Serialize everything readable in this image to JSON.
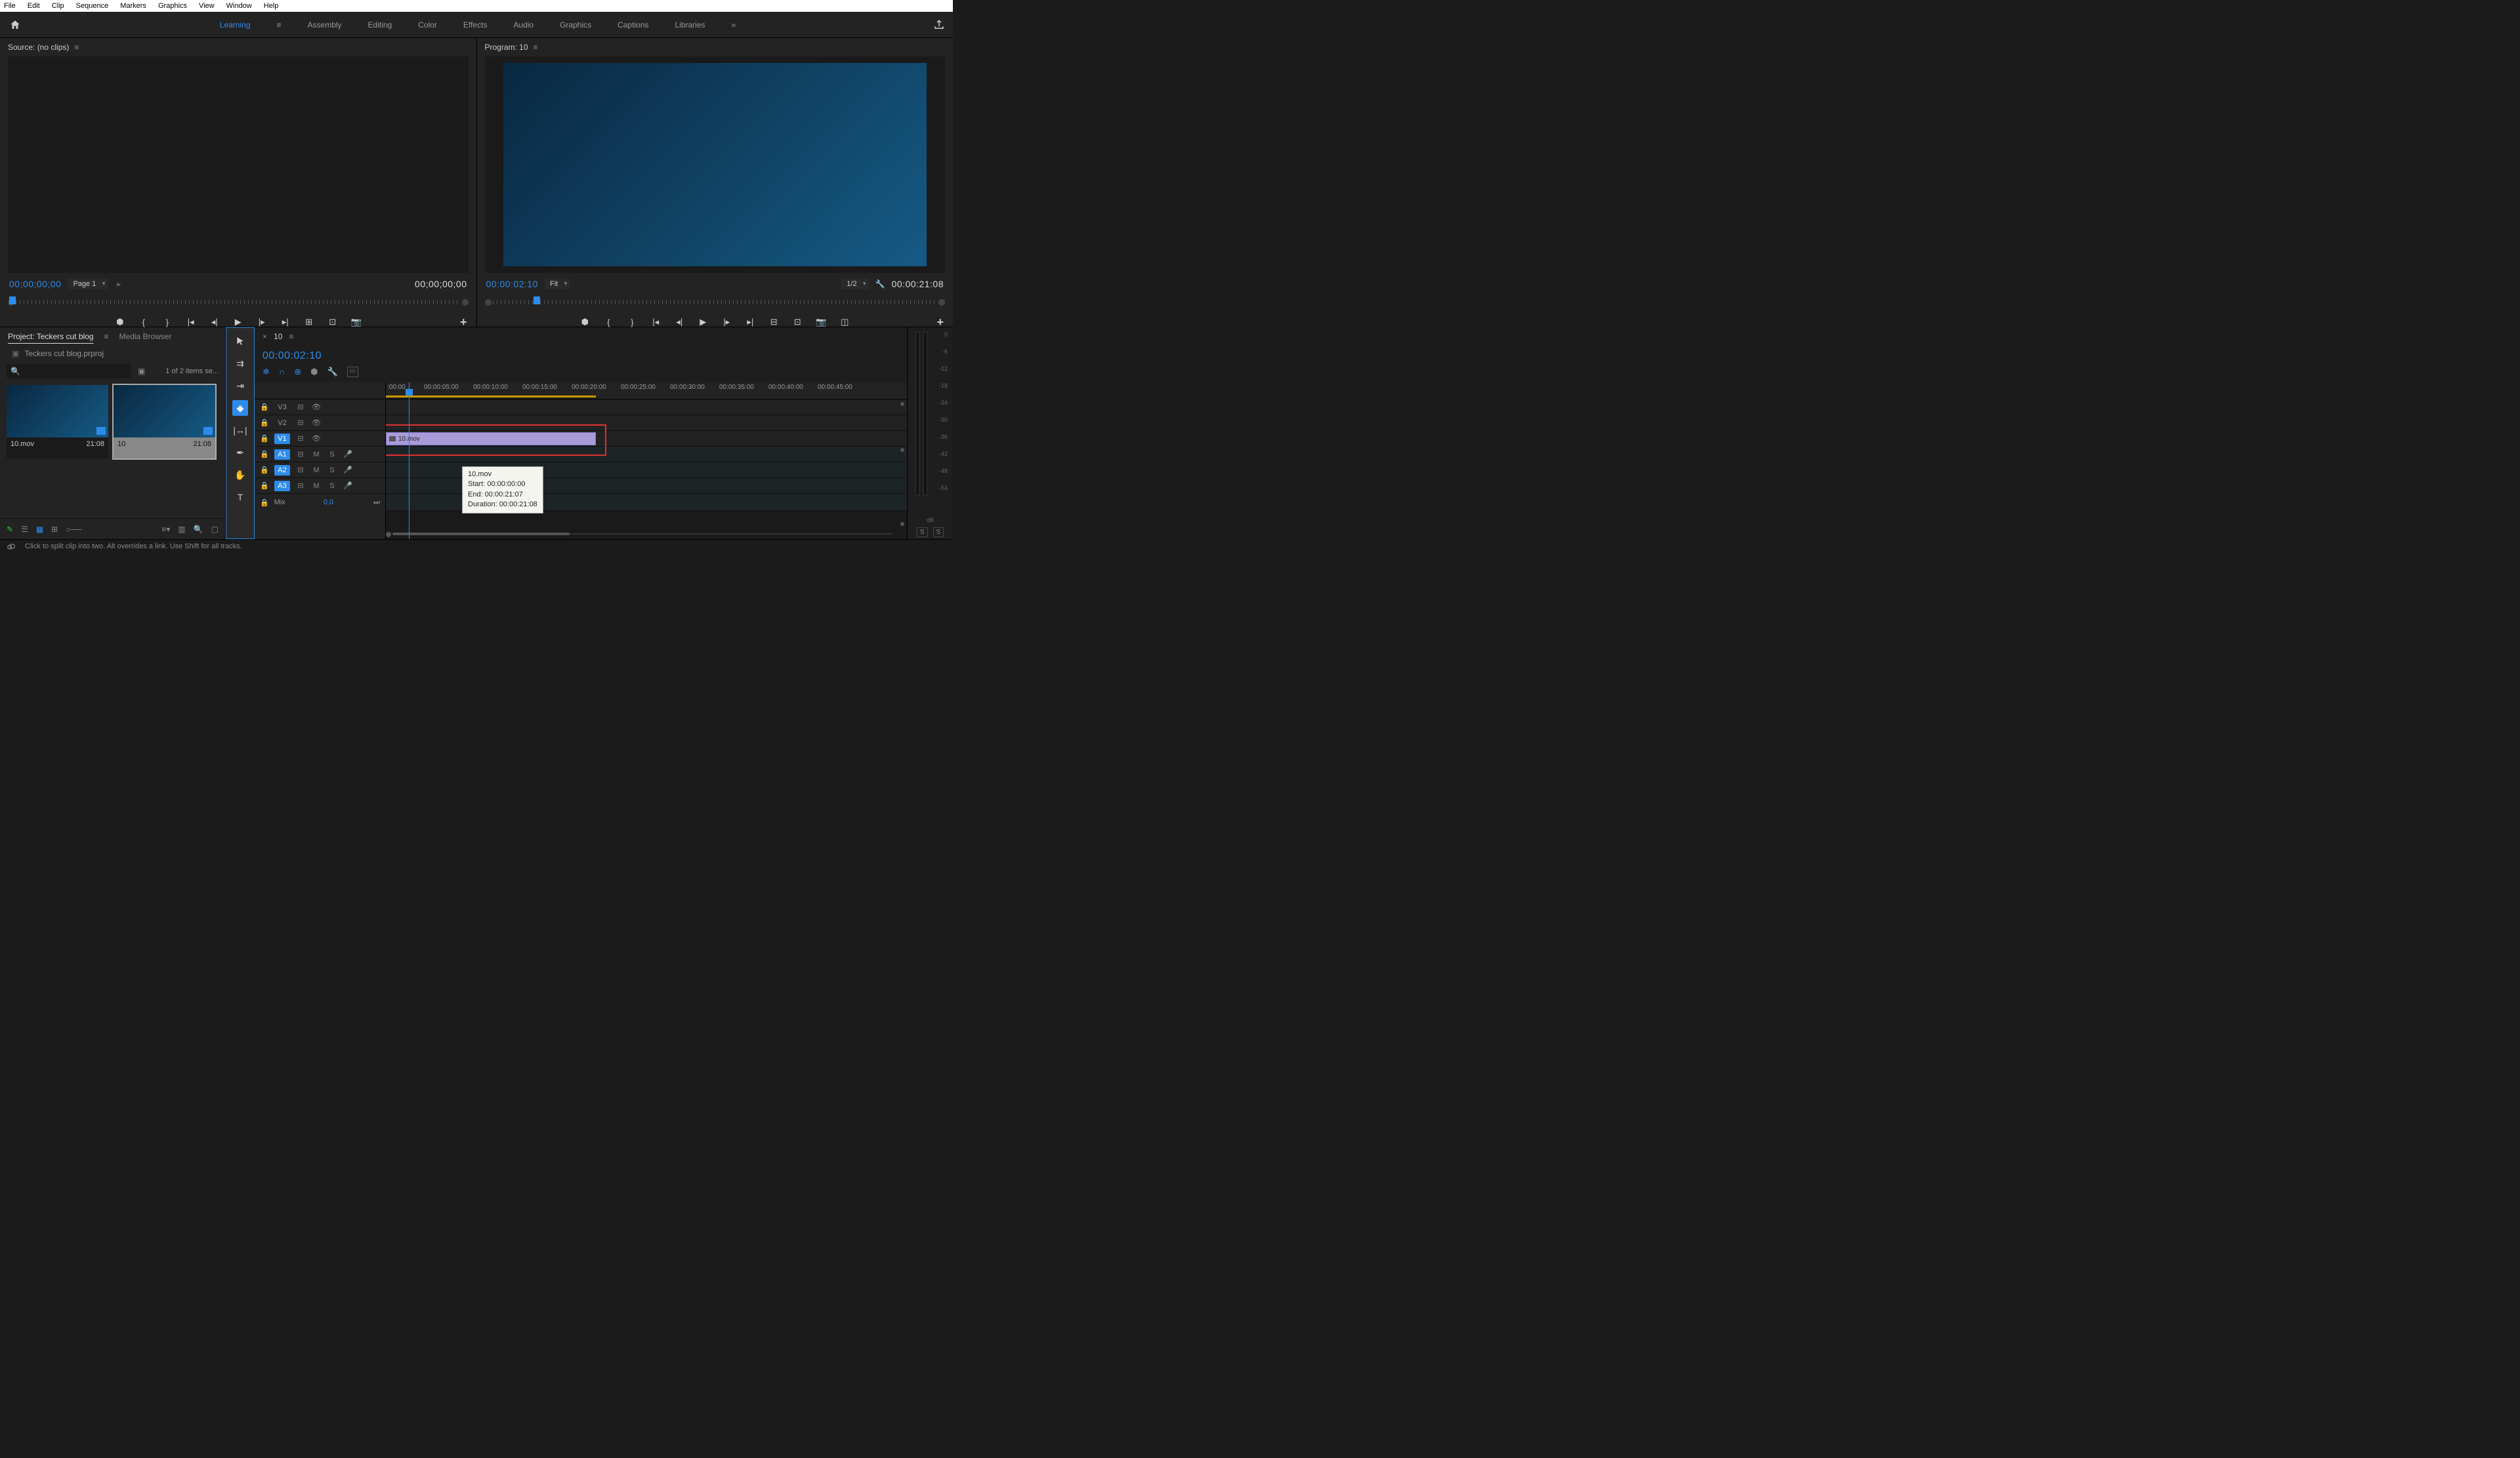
{
  "menubar": [
    "File",
    "Edit",
    "Clip",
    "Sequence",
    "Markers",
    "Graphics",
    "View",
    "Window",
    "Help"
  ],
  "workspaces": {
    "items": [
      "Learning",
      "Assembly",
      "Editing",
      "Color",
      "Effects",
      "Audio",
      "Graphics",
      "Captions",
      "Libraries"
    ],
    "active": "Learning"
  },
  "source": {
    "title": "Source: (no clips)",
    "timecode_left": "00;00;00;00",
    "timecode_right": "00;00;00;00",
    "page_selector": "Page 1"
  },
  "program": {
    "title": "Program: 10",
    "timecode_left": "00:00:02:10",
    "timecode_right": "00:00:21:08",
    "zoom": "Fit",
    "scale": "1/2"
  },
  "project": {
    "tabs": [
      "Project: Teckers cut blog",
      "Media Browser"
    ],
    "active_tab": "Project: Teckers cut blog",
    "filename": "Teckers cut blog.prproj",
    "item_count": "1 of 2 items se...",
    "bins": [
      {
        "name": "10.mov",
        "duration": "21:08"
      },
      {
        "name": "10",
        "duration": "21:08"
      }
    ]
  },
  "timeline": {
    "seq_name": "10",
    "timecode": "00:00:02:10",
    "ruler_ticks": [
      ":00:00",
      "00:00:05:00",
      "00:00:10:00",
      "00:00:15:00",
      "00:00:20:00",
      "00:00:25:00",
      "00:00:30:00",
      "00:00:35:00",
      "00:00:40:00",
      "00:00:45:00"
    ],
    "video_tracks": [
      {
        "label": "V3",
        "active": false
      },
      {
        "label": "V2",
        "active": false
      },
      {
        "label": "V1",
        "active": true
      }
    ],
    "audio_tracks": [
      {
        "label": "A1",
        "active": true
      },
      {
        "label": "A2",
        "active": true
      },
      {
        "label": "A3",
        "active": true
      }
    ],
    "mix": {
      "label": "Mix",
      "value": "0.0"
    },
    "clip": {
      "name": "10.mov"
    },
    "tooltip": {
      "name": "10.mov",
      "start": "Start: 00:00:00:00",
      "end": "End: 00:00:21:07",
      "duration": "Duration: 00:00:21:08"
    }
  },
  "meters": {
    "scale": [
      "0",
      "-6",
      "-12",
      "-18",
      "-24",
      "-30",
      "-36",
      "-42",
      "-48",
      "-54"
    ],
    "db_label": "dB"
  },
  "statusbar": {
    "hint": "Click to split clip into two. Alt overrides a link. Use Shift for all tracks."
  }
}
